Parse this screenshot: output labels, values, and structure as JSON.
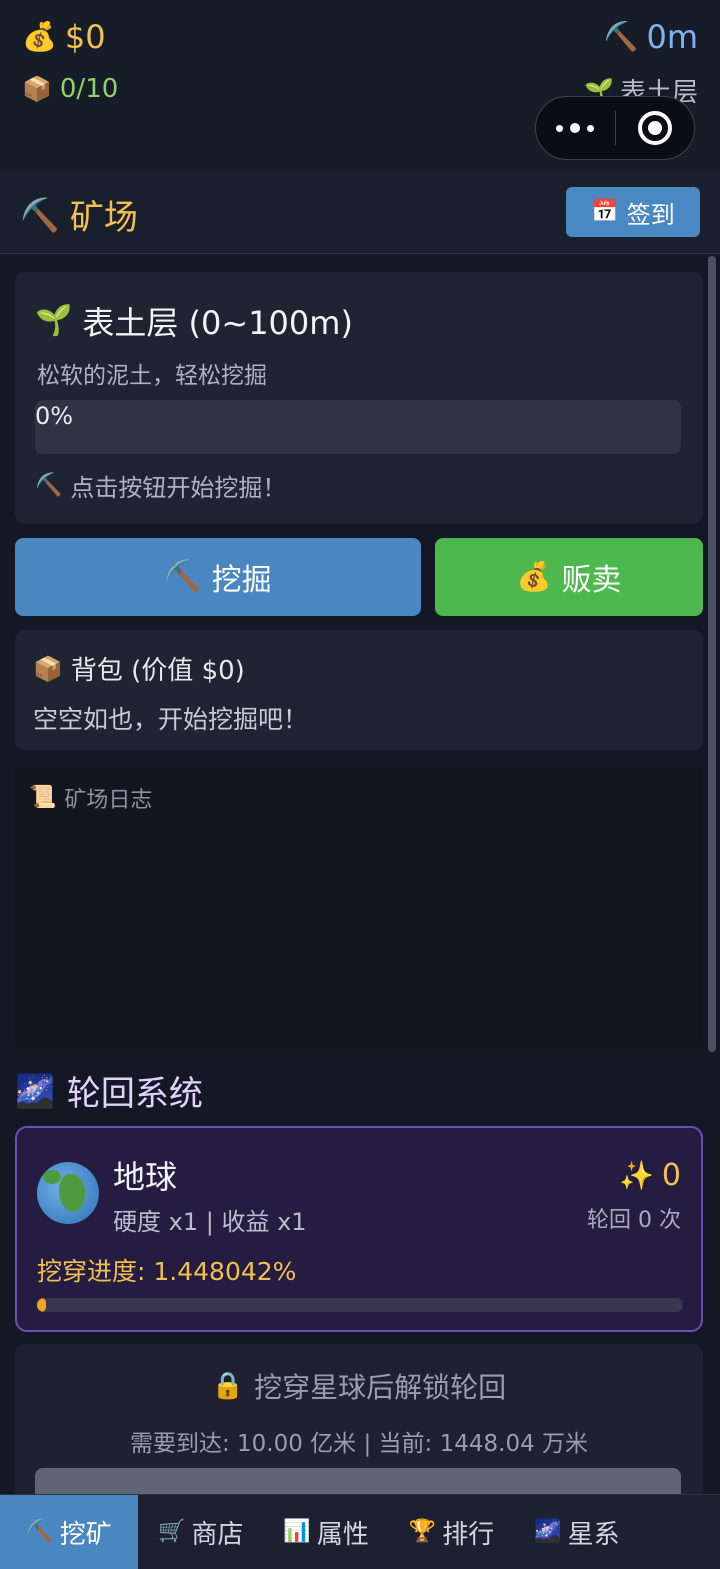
{
  "topbar": {
    "money": "$0",
    "bag_count": "0/10",
    "depth": "0m",
    "layer": "表土层"
  },
  "header": {
    "title": "矿场",
    "checkin_label": "签到"
  },
  "layer_card": {
    "title": "表土层 (0~100m)",
    "desc": "松软的泥土，轻松挖掘",
    "progress_text": "0%",
    "hint": "点击按钮开始挖掘！"
  },
  "actions": {
    "dig_label": "挖掘",
    "sell_label": "贩卖"
  },
  "backpack": {
    "title": "背包 (价值 $0)",
    "empty": "空空如也，开始挖掘吧！"
  },
  "log": {
    "title": "矿场日志"
  },
  "rebirth": {
    "title": "轮回系统",
    "planet_name": "地球",
    "multipliers": "硬度 x1 | 收益 x1",
    "stars": "0",
    "rebirth_count": "轮回 0 次",
    "progress_label": "挖穿进度: 1.448042%",
    "progress_fraction": 0.0145,
    "lock_title": "挖穿星球后解锁轮回",
    "lock_req": "需要到达: 10.00 亿米 | 当前: 1448.04 万米"
  },
  "tabs": [
    {
      "label": "挖矿"
    },
    {
      "label": "商店"
    },
    {
      "label": "属性"
    },
    {
      "label": "排行"
    },
    {
      "label": "星系"
    }
  ],
  "colors": {
    "gold": "#f1c14d",
    "dig_blue": "#4a87c0",
    "sell_green": "#4cb84e",
    "rebirth_purple": "#6a4fb5"
  }
}
